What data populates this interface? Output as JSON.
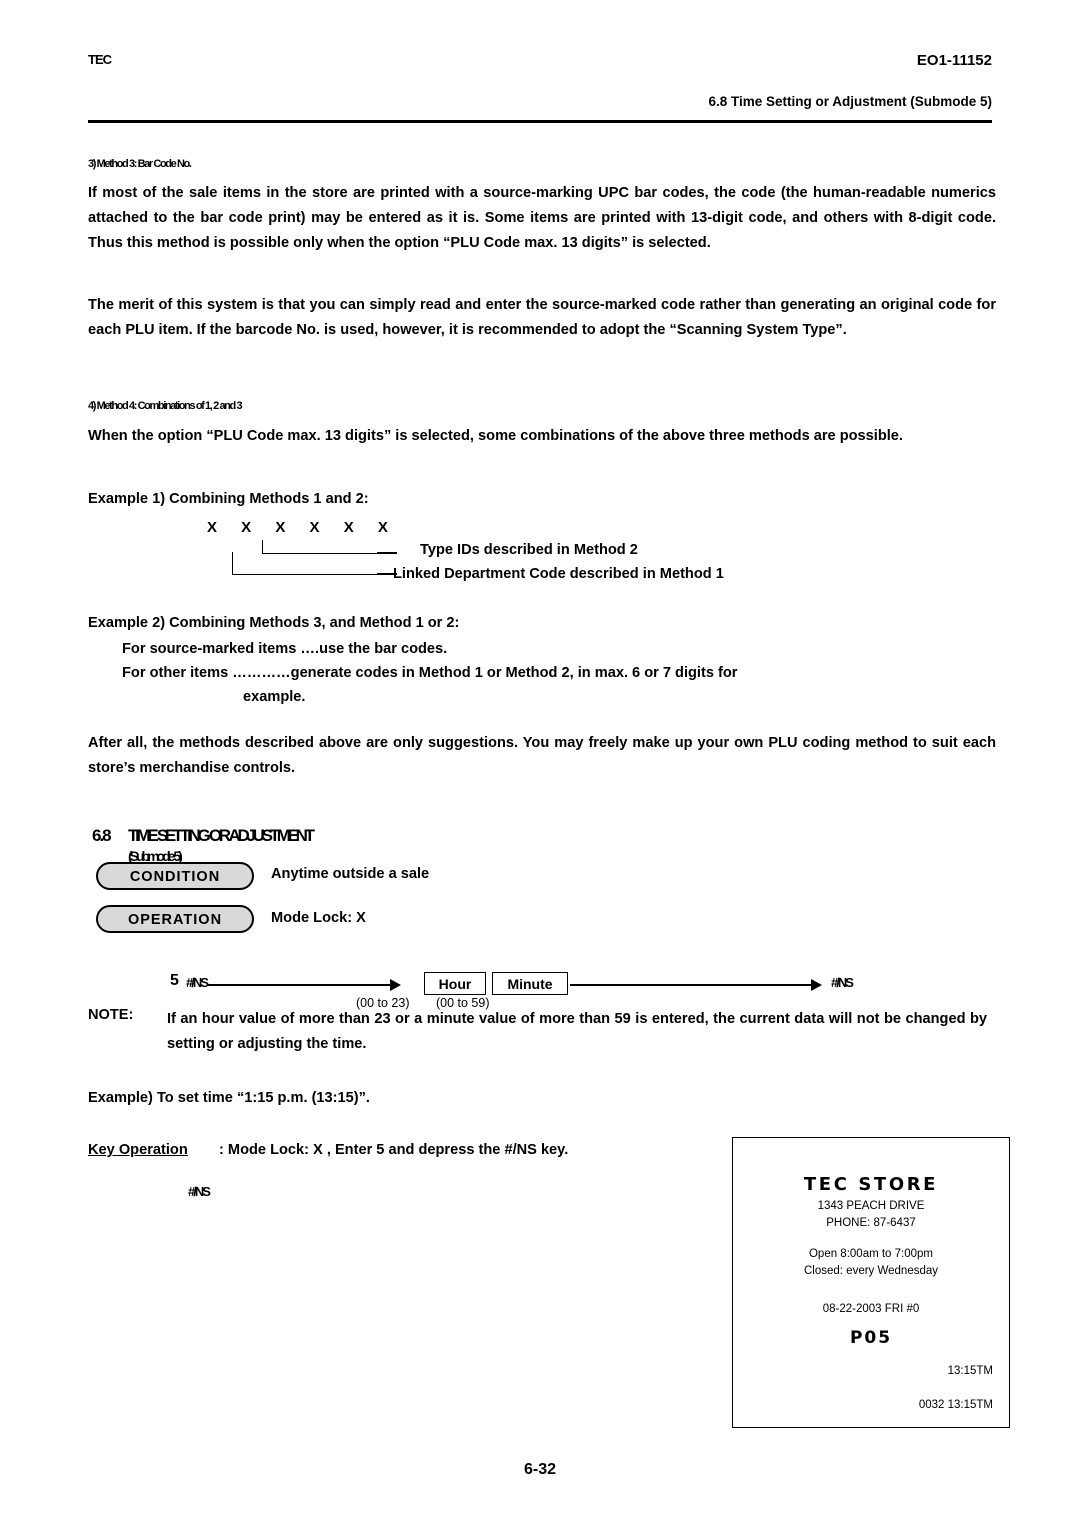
{
  "header": {
    "left_mark": "TEC",
    "doc_code": "EO1-11152",
    "section_ref": "6.8 Time Setting or Adjustment (Submode 5)"
  },
  "method3": {
    "label": "3) Method 3:  Bar Code No.",
    "paragraph1": "If most of the sale items in the store are printed with a source-marking UPC bar codes, the code (the human-readable numerics attached to the bar code print) may be entered as it is.  Some items are printed with 13-digit code, and others with 8-digit code.  Thus this method is possible only when the option “PLU Code max. 13 digits” is selected.",
    "paragraph2": "The merit of this system is that you can simply read and enter the source-marked code rather than generating an original code for each PLU item.  If the barcode No. is used, however, it is recommended to adopt the “Scanning System Type”."
  },
  "method4": {
    "label": "4) Method 4:  Combinations of 1, 2 and 3",
    "paragraph": "When the option “PLU Code max. 13 digits” is selected, some combinations of the above three methods are possible.",
    "example1_title": "Example 1) Combining Methods 1 and 2:",
    "x_row": "X X X X X X",
    "callout1": "Type IDs described in Method 2",
    "callout2": "Linked Department Code described in Method 1",
    "example2_title": "Example 2) Combining Methods 3, and Method 1 or 2:",
    "example2_line1": "For source-marked items ….use the bar codes.",
    "example2_line2": "For other items …………generate codes in Method 1 or Method 2, in max. 6 or 7 digits for",
    "example2_line3": "example.",
    "closing": "After all, the methods described above are only suggestions.  You may freely make up your own PLU coding method to suit each store’s merchandise controls."
  },
  "section": {
    "number": "6.8",
    "title": "TIME SETTING OR ADJUSTMENT",
    "subtitle": "(Submode 5)",
    "condition_label": "CONDITION",
    "condition_text": "Anytime outside a sale",
    "operation_label": "OPERATION",
    "operation_text": "Mode Lock:  X",
    "flow": {
      "step_num": "5",
      "step_key": "#/NS",
      "hour_key": "Hour",
      "hour_range": "(00 to 23)",
      "minute_key": "Minute",
      "minute_range": "(00 to 59)",
      "end_key": "#/NS"
    },
    "note_label": "NOTE:",
    "note_text": "If an hour value of more than 23 or a minute value of more than 59 is entered, the current data will not be changed by setting or adjusting the time.",
    "example_title": "Example) To set time “1:15 p.m. (13:15)”.",
    "key_operation_label": "Key Operation",
    "key_operation_text": ": Mode Lock:  X  ,  Enter 5 and depress the  #/NS  key.",
    "result_key": "#/NS"
  },
  "receipt": {
    "store_name": "TEC STORE",
    "address": "1343 PEACH DRIVE",
    "phone": "PHONE: 87-6437",
    "open": "Open  8:00am to 7:00pm",
    "closed": "Closed: every Wednesday",
    "date_line": "08-22-2003 FRI  #0",
    "code": "P05",
    "time1": "13:15TM",
    "time2": "0032 13:15TM"
  },
  "footer": {
    "page": "6-32"
  }
}
